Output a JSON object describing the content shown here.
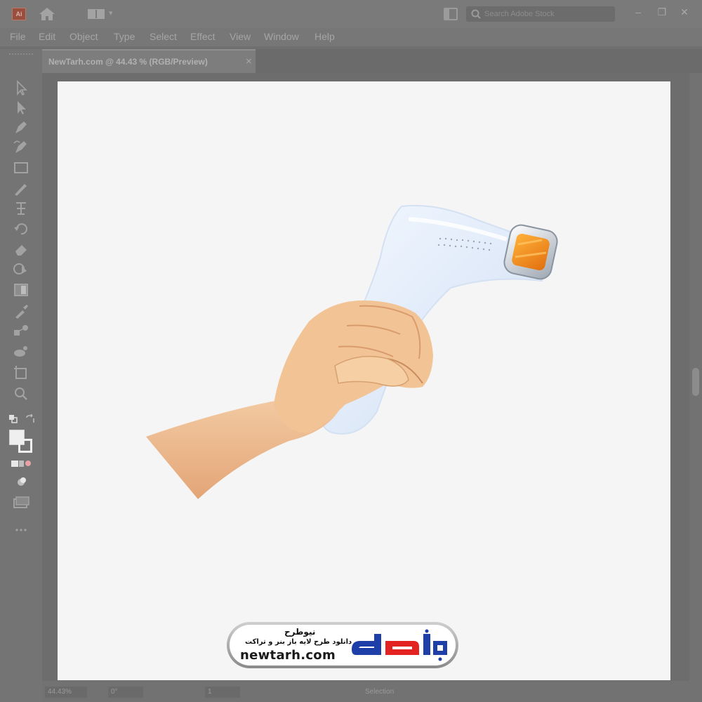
{
  "app": {
    "logo_text": "Ai"
  },
  "titlebar": {
    "search_placeholder": "Search Adobe Stock"
  },
  "window_controls": {
    "minimize": "–",
    "restore": "❐",
    "close": "✕"
  },
  "menu": [
    "File",
    "Edit",
    "Object",
    "Type",
    "Select",
    "Effect",
    "View",
    "Window",
    "Help"
  ],
  "document_tab": {
    "label": "NewTarh.com @ 44.43 % (RGB/Preview)",
    "close": "×"
  },
  "tools": [
    "selection-tool",
    "direct-selection-tool",
    "pen-tool",
    "curvature-tool",
    "rectangle-tool",
    "paintbrush-tool",
    "type-tool",
    "rotate-tool",
    "eraser-tool",
    "shape-builder-tool",
    "gradient-tool",
    "eyedropper-tool",
    "blend-tool",
    "symbol-sprayer-tool",
    "artboard-tool",
    "zoom-tool"
  ],
  "statusbar": {
    "zoom": "44.43%",
    "rotation": "0°",
    "artboard_num": "1",
    "tool_name": "Selection"
  },
  "colors": {
    "artboard": "#f5f5f5",
    "skin": "#f2c79d",
    "device": "#e7f0fb",
    "lamp": "#f08a17"
  },
  "watermark": {
    "brand_fa": "نیوطرح",
    "tagline_fa": "دانلود طرح لایه باز بنر و تراکت",
    "url": "newtarh.com",
    "logo_fa": "نیوطرح",
    "logo_colors": [
      "#1e3fa8",
      "#e32222"
    ]
  }
}
